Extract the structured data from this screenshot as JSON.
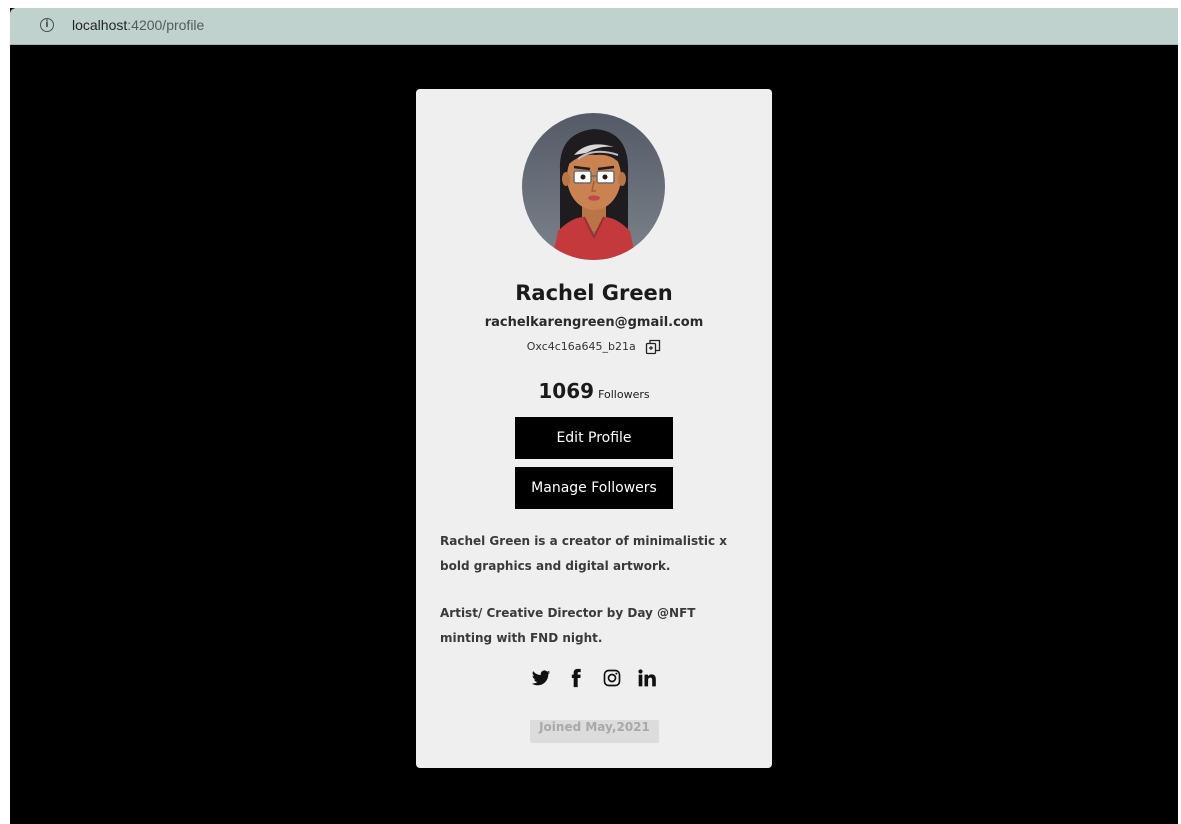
{
  "browser": {
    "url_host": "localhost",
    "url_path": ":4200/profile"
  },
  "profile": {
    "name": "Rachel Green",
    "email": "rachelkarengreen@gmail.com",
    "wallet": "Oxc4c16a645_b21a",
    "followers_count": "1069",
    "followers_label": "Followers",
    "edit_label": "Edit Profile",
    "manage_label": "Manage Followers",
    "bio_1": "Rachel Green is a creator of minimalistic x bold graphics and digital artwork.",
    "bio_2": "Artist/ Creative Director by Day @NFT minting with FND night.",
    "joined": "Joined May,2021"
  },
  "socials": [
    {
      "icon": "twitter-icon"
    },
    {
      "icon": "facebook-icon"
    },
    {
      "icon": "instagram-icon"
    },
    {
      "icon": "linkedin-icon"
    }
  ],
  "colors": {
    "page_bg": "#000000",
    "card_bg": "#efefef",
    "button_bg": "#000000",
    "button_text": "#ffffff",
    "urlbar_bg": "#c0d2cd"
  }
}
